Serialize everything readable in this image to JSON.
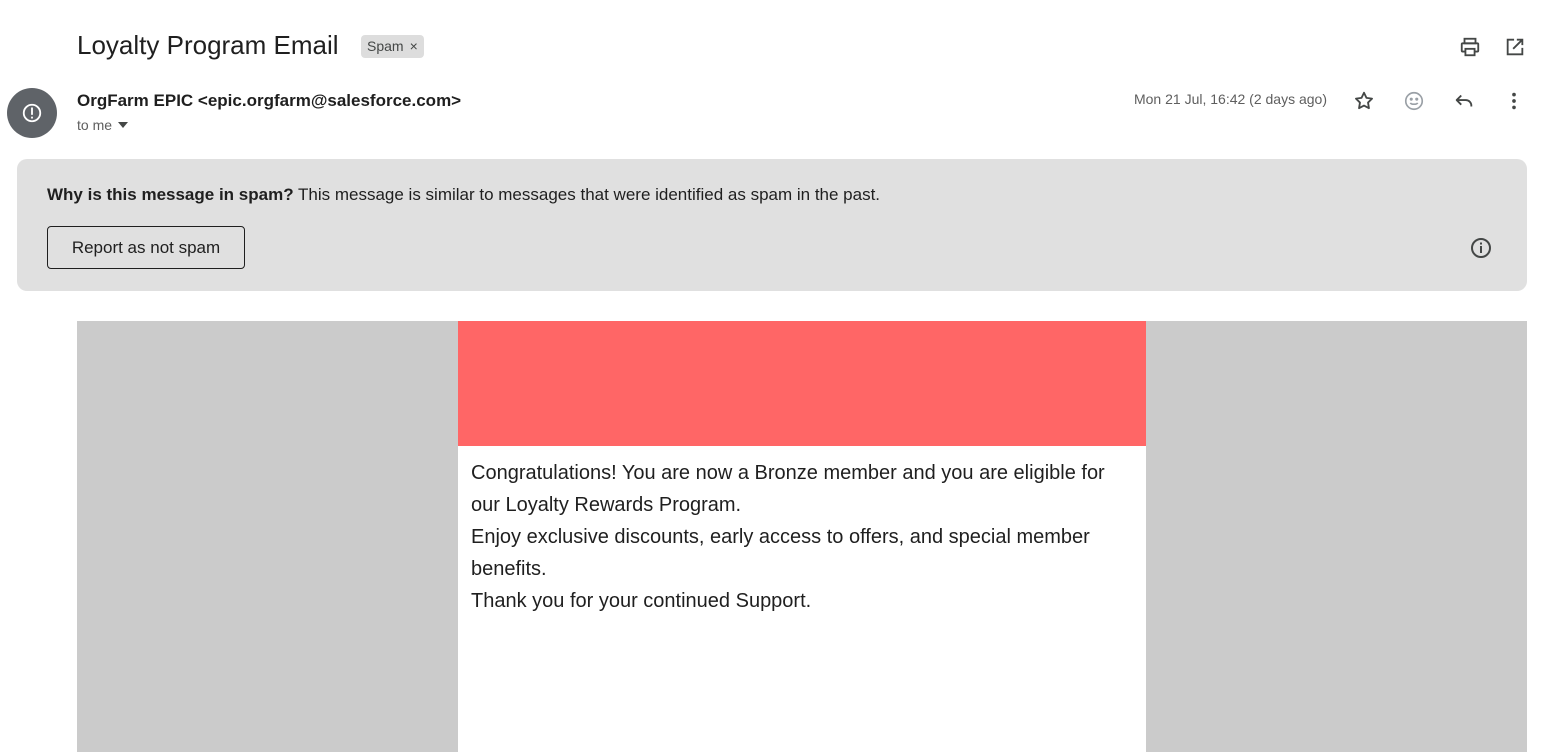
{
  "email": {
    "subject": "Loyalty Program Email",
    "label_chip": "Spam",
    "label_chip_remove": "×",
    "sender": "OrgFarm EPIC <epic.orgfarm@salesforce.com>",
    "recipient": "to me",
    "date": "Mon 21 Jul, 16:42 (2 days ago)"
  },
  "spam_banner": {
    "heading": "Why is this message in spam?",
    "explanation": "This message is similar to messages that were identified as spam in the past.",
    "report_button": "Report as not spam"
  },
  "message": {
    "header_color": "#ff6666",
    "lines": [
      "Congratulations! You are now a Bronze member and you are eligible for our Loyalty Rewards Program.",
      "Enjoy exclusive discounts, early access to offers, and special member benefits.",
      "Thank you for your continued Support."
    ]
  },
  "icons": {
    "print": "print-icon",
    "open_new_window": "open-in-new-window-icon",
    "avatar": "spam-warning-icon",
    "star": "star-icon",
    "emoji": "emoji-reaction-icon",
    "reply": "reply-icon",
    "more": "more-vertical-icon",
    "info": "info-icon",
    "dropdown": "chevron-down-icon"
  }
}
